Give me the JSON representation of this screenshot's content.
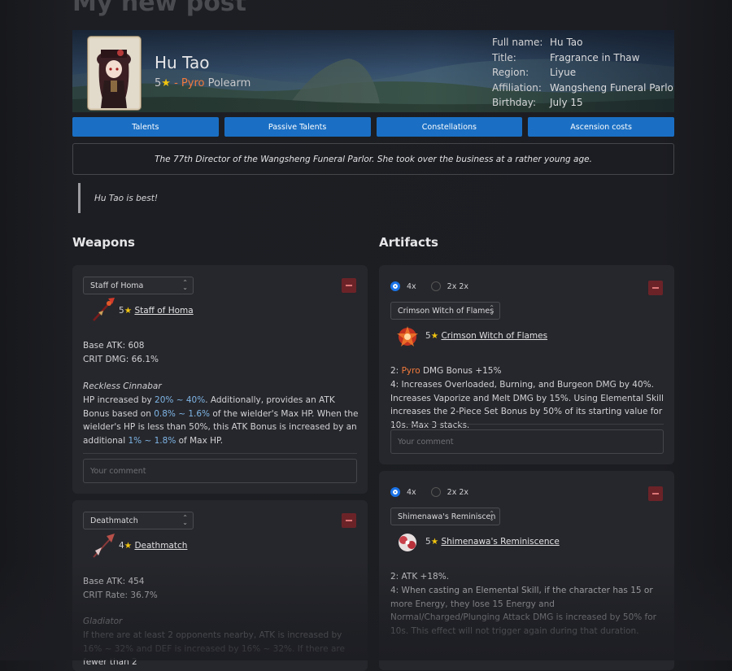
{
  "page_title": "My new post",
  "character": {
    "name": "Hu Tao",
    "rarity": "5",
    "separator": " - ",
    "element": "Pyro",
    "weapon_type": "Polearm",
    "info": [
      {
        "label": "Full name:",
        "value": "Hu Tao"
      },
      {
        "label": "Title:",
        "value": "Fragrance in Thaw"
      },
      {
        "label": "Region:",
        "value": "Liyue"
      },
      {
        "label": "Affiliation:",
        "value": "Wangsheng Funeral Parlor"
      },
      {
        "label": "Birthday:",
        "value": "July 15"
      }
    ]
  },
  "tabs": [
    "Talents",
    "Passive Talents",
    "Constellations",
    "Ascension costs"
  ],
  "description": "The 77th Director of the Wangsheng Funeral Parlor. She took over the business at a rather young age.",
  "quote": "Hu Tao is best!",
  "weapons_heading": "Weapons",
  "artifacts_heading": "Artifacts",
  "comment_placeholder": "Your comment",
  "weapons": [
    {
      "select": "Staff of Homa",
      "rarity": "5",
      "name": "Staff of Homa",
      "stat1": "Base ATK: 608",
      "stat2": "CRIT DMG: 66.1%",
      "passive_name": "Reckless Cinnabar",
      "p": [
        "HP increased by ",
        "20% ~ 40%",
        ". Additionally, provides an ATK Bonus based on ",
        "0.8% ~ 1.6%",
        " of the wielder's Max HP. When the wielder's HP is less than 50%, this ATK Bonus is increased by an additional ",
        "1% ~ 1.8%",
        " of Max HP."
      ]
    },
    {
      "select": "Deathmatch",
      "rarity": "4",
      "name": "Deathmatch",
      "stat1": "Base ATK: 454",
      "stat2": "CRIT Rate: 36.7%",
      "passive_name": "Gladiator",
      "p": [
        "If there are at least 2 opponents nearby, ATK is increased by 16% ~ 32% and DEF is increased by 16% ~ 32%. If there are fewer than 2"
      ]
    }
  ],
  "artifacts": [
    {
      "opt1": "4x",
      "opt2": "2x 2x",
      "select": "Crimson Witch of Flames",
      "rarity": "5",
      "name": "Crimson Witch of Flames",
      "bonus2_prefix": "2: ",
      "bonus2_element": "Pyro",
      "bonus2_rest": " DMG Bonus +15%",
      "bonus4": "4: Increases Overloaded, Burning, and Burgeon DMG by 40%. Increases Vaporize and Melt DMG by 15%. Using Elemental Skill increases the 2-Piece Set Bonus by 50% of its starting value for 10s. Max 3 stacks."
    },
    {
      "opt1": "4x",
      "opt2": "2x 2x",
      "select": "Shimenawa's Reminiscen",
      "rarity": "5",
      "name": "Shimenawa's Reminiscence",
      "bonus2": "2: ATK +18%.",
      "bonus4": "4: When casting an Elemental Skill, if the character has 15 or more Energy, they lose 15 Energy and Normal/Charged/Plunging Attack DMG is increased by 50% for 10s. This effect will not trigger again during that duration."
    }
  ],
  "colors": {
    "accent": "#1a6fc4",
    "pyro": "#f27a3c",
    "star": "#f1c40f",
    "highlight": "#7fb5e6",
    "remove": "#6b2328"
  },
  "icons": [
    "star-icon",
    "chevron-updown-icon",
    "minus-icon",
    "staff-of-homa-icon",
    "deathmatch-icon",
    "crimson-witch-icon",
    "shimenawa-icon"
  ]
}
